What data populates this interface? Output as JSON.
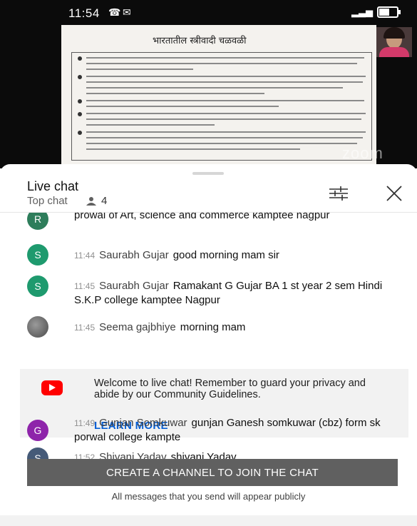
{
  "status_bar": {
    "time": "11:54"
  },
  "slide": {
    "title": "भारतातील स्त्रीवादी चळवळी"
  },
  "video": {
    "watermark": "zoom"
  },
  "chat": {
    "title": "Live chat",
    "mode": "Top chat",
    "viewers": "4",
    "messages": [
      {
        "initial": "R",
        "color": "#2e7d5b",
        "time": "",
        "author": "",
        "text": "prowal of Art, science and commerce kamptee nagpur"
      },
      {
        "initial": "S",
        "color": "#1e9a6e",
        "time": "11:44",
        "author": "Saurabh Gujar",
        "text": "good morning mam sir"
      },
      {
        "initial": "S",
        "color": "#1e9a6e",
        "time": "11:45",
        "author": "Saurabh Gujar",
        "text": "Ramakant G Gujar BA 1 st year 2 sem Hindi S.K.P college kamptee Nagpur"
      },
      {
        "initial": "",
        "color": "#6d6d6d",
        "time": "11:45",
        "author": "Seema gajbhiye",
        "text": "morning mam"
      },
      {
        "initial": "G",
        "color": "#8e24aa",
        "time": "11:49",
        "author": "Gunjan Somkuwar",
        "text": "gunjan Ganesh somkuwar (cbz) form sk porwal college kampte"
      },
      {
        "initial": "S",
        "color": "#455a78",
        "time": "11:52",
        "author": "Shivani Yadav",
        "text": "shivani Yadav"
      }
    ],
    "welcome": {
      "text": "Welcome to live chat! Remember to guard your privacy and abide by our Community Guidelines.",
      "learn_more": "LEARN MORE"
    },
    "create_channel_label": "CREATE A CHANNEL TO JOIN THE CHAT",
    "notice": "All messages that you send will appear publicly"
  }
}
